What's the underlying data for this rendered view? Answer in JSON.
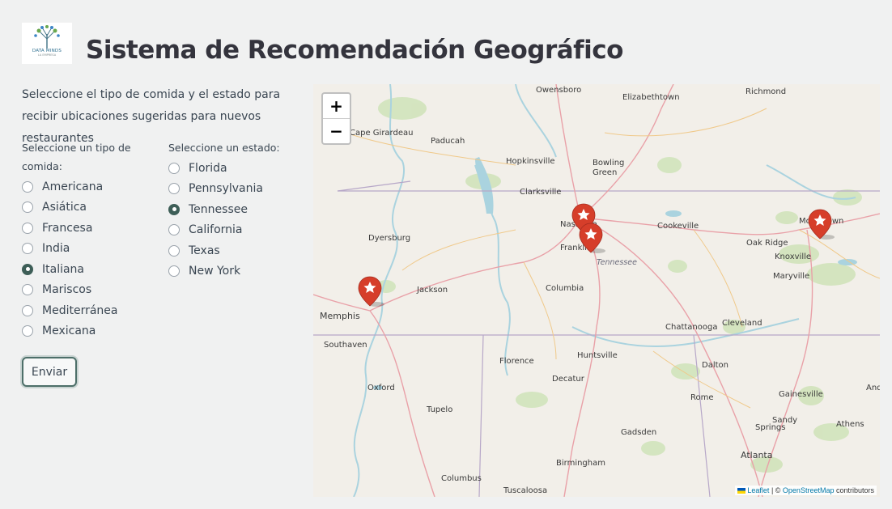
{
  "logo": {
    "brand": "DATA MINDS",
    "sub": "LA EMPRESA"
  },
  "title": "Sistema de Recomendación Geográfico",
  "intro": "Seleccione el tipo de comida y el estado para recibir ubicaciones sugeridas para nuevos restaurantes",
  "food": {
    "label": "Seleccione un tipo de comida:",
    "options": [
      "Americana",
      "Asiática",
      "Francesa",
      "India",
      "Italiana",
      "Mariscos",
      "Mediterránea",
      "Mexicana"
    ],
    "selected": "Italiana"
  },
  "state": {
    "label": "Seleccione un estado:",
    "options": [
      "Florida",
      "Pennsylvania",
      "Tennessee",
      "California",
      "Texas",
      "New York"
    ],
    "selected": "Tennessee"
  },
  "submit_label": "Enviar",
  "map": {
    "zoom_in": "+",
    "zoom_out": "−",
    "marker_color": "#d63e2a",
    "marker_icon": "star-icon",
    "places": [
      "Owensboro",
      "Elizabethtown",
      "Richmond",
      "Cape Girardeau",
      "Paducah",
      "Hopkinsville",
      "Bowling Green",
      "Clarksville",
      "Nashville",
      "Cookeville",
      "Oak Ridge",
      "Morristown",
      "Dyersburg",
      "Franklin",
      "Tennessee",
      "Knoxville",
      "Jackson",
      "Columbia",
      "Maryville",
      "Memphis",
      "Chattanooga",
      "Cleveland",
      "Southaven",
      "Huntsville",
      "Florence",
      "Dalton",
      "Decatur",
      "Oxford",
      "Gainesville",
      "Rome",
      "Tupelo",
      "Sandy Springs",
      "Athens",
      "Gadsden",
      "Atlanta",
      "Birmingham",
      "Columbus",
      "Tuscaloosa",
      "And"
    ],
    "attribution": {
      "leaflet": "Leaflet",
      "sep": " | © ",
      "osm": "OpenStreetMap",
      "tail": " contributors"
    }
  }
}
